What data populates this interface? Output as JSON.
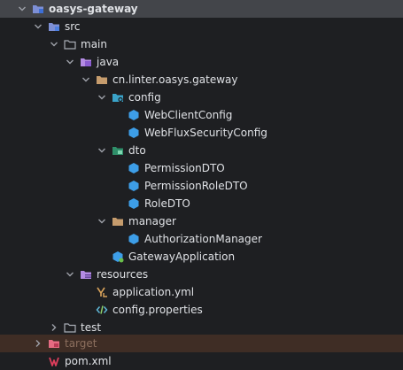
{
  "tree": {
    "project_name": "oasys-gateway",
    "src": "src",
    "main": "main",
    "java": "java",
    "package": "cn.linter.oasys.gateway",
    "config": "config",
    "web_client_config": "WebClientConfig",
    "web_flux_security_config": "WebFluxSecurityConfig",
    "dto": "dto",
    "permission_dto": "PermissionDTO",
    "permission_role_dto": "PermissionRoleDTO",
    "role_dto": "RoleDTO",
    "manager": "manager",
    "authorization_manager": "AuthorizationManager",
    "gateway_application": "GatewayApplication",
    "resources": "resources",
    "application_yml": "application.yml",
    "config_properties": "config.properties",
    "test": "test",
    "target": "target",
    "pom_xml": "pom.xml"
  },
  "colors": {
    "background": "#1e1f22",
    "selected_row": "#43454a",
    "excluded_row": "#3f2d25",
    "folder": "#c69c6d",
    "java_class": "#3d9ee8",
    "source_root": "#7a8fd6",
    "resource_root": "#b48be3",
    "pom": "#e03e5c"
  }
}
